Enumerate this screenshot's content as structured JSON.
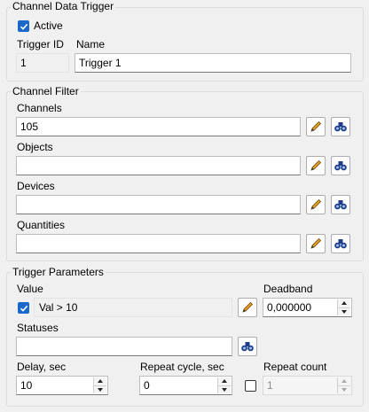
{
  "channel_data_trigger": {
    "legend": "Channel Data Trigger",
    "active_label": "Active",
    "trigger_id_label": "Trigger ID",
    "trigger_id_value": "1",
    "name_label": "Name",
    "name_value": "Trigger 1"
  },
  "channel_filter": {
    "legend": "Channel Filter",
    "channels_label": "Channels",
    "channels_value": "105",
    "objects_label": "Objects",
    "objects_value": "",
    "devices_label": "Devices",
    "devices_value": "",
    "quantities_label": "Quantities",
    "quantities_value": ""
  },
  "trigger_parameters": {
    "legend": "Trigger Parameters",
    "value_label": "Value",
    "value_expression": "Val > 10",
    "deadband_label": "Deadband",
    "deadband_value": "0,000000",
    "statuses_label": "Statuses",
    "statuses_value": "",
    "delay_label": "Delay, sec",
    "delay_value": "10",
    "repeat_cycle_label": "Repeat cycle, sec",
    "repeat_cycle_value": "0",
    "repeat_count_label": "Repeat count",
    "repeat_count_value": "1"
  },
  "icons": {
    "edit": "pencil-icon",
    "browse": "binoculars-icon",
    "accent": "#1a68c9"
  }
}
